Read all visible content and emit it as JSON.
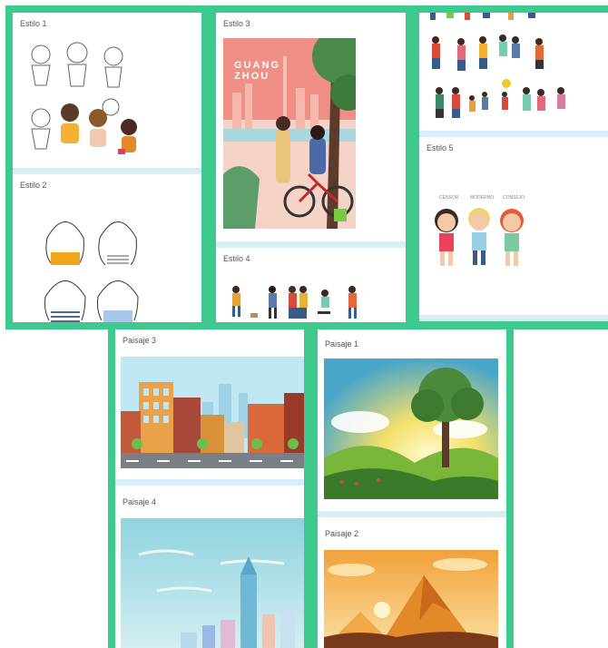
{
  "collage": {
    "cards": {
      "estilo1": "Estilo 1",
      "estilo2": "Estilo 2",
      "estilo3": "Estilo 3",
      "estilo4": "Estilo 4",
      "estilo5": "Estilo 5",
      "paisaje1": "Paisaje 1",
      "paisaje2": "Paisaje 2",
      "paisaje3": "Paisaje 3",
      "paisaje4": "Paisaje 4"
    },
    "poster": {
      "city": "GUANG\nZHOU"
    },
    "estilo5_names": [
      "CENSOR",
      "MODERNO",
      "CONSEJO"
    ]
  },
  "colors": {
    "border": "#3ec98f",
    "divider": "#d8eef6"
  }
}
